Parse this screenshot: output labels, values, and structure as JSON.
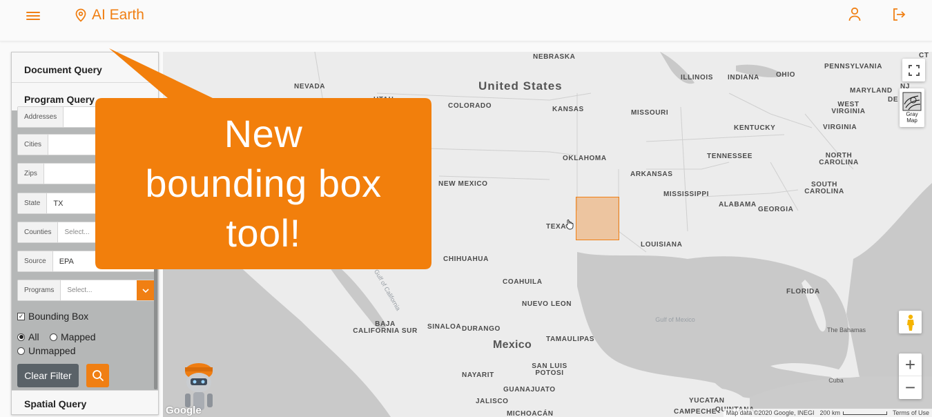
{
  "header": {
    "brand": "AI Earth",
    "menu_icon": "hamburger-icon",
    "pin_icon": "map-pin-icon",
    "user_icon": "user-icon",
    "logout_icon": "logout-icon",
    "accent": "#f07f13"
  },
  "sidebar": {
    "document_query": "Document Query",
    "program_query": "Program Query",
    "spatial_query": "Spatial Query",
    "fields": {
      "addresses": {
        "label": "Addresses",
        "value": ""
      },
      "cities": {
        "label": "Cities",
        "value": ""
      },
      "zips": {
        "label": "Zips",
        "value": ""
      },
      "state": {
        "label": "State",
        "value": "TX"
      },
      "counties": {
        "label": "Counties",
        "placeholder": "Select..."
      },
      "source": {
        "label": "Source",
        "value": "EPA"
      },
      "programs": {
        "label": "Programs",
        "placeholder": "Select..."
      }
    },
    "bounding_box_label": "Bounding Box",
    "bounding_box_checked": true,
    "radio_all": "All",
    "radio_mapped": "Mapped",
    "radio_unmapped": "Unmapped",
    "radio_selected": "All",
    "clear_filter": "Clear Filter",
    "search_icon": "search-icon"
  },
  "callout": {
    "line1": "New",
    "line2": "bounding box",
    "line3": "tool!",
    "color": "#f27f0c"
  },
  "map": {
    "country_us": "United States",
    "country_mexico": "Mexico",
    "states": [
      "NEBRASKA",
      "NEVADA",
      "UTAH",
      "COLORADO",
      "KANSAS",
      "MISSOURI",
      "ILLINOIS",
      "INDIANA",
      "OHIO",
      "PENNSYLVANIA",
      "MARYLAND",
      "NJ",
      "DE",
      "WEST VIRGINIA",
      "VIRGINIA",
      "KENTUCKY",
      "TENNESSEE",
      "NORTH CAROLINA",
      "OKLAHOMA",
      "ARKANSAS",
      "NEW MEXICO",
      "SOUTH CAROLINA",
      "MISSISSIPPI",
      "ALABAMA",
      "GEORGIA",
      "TEXAS",
      "LOUISIANA",
      "CHIHUAHUA",
      "COAHUILA",
      "FLORIDA",
      "NUEVO LEON",
      "BAJA CALIFORNIA SUR",
      "SINALOA",
      "DURANGO",
      "TAMAULIPAS",
      "SAN LUIS POTOSI",
      "NAYARIT",
      "GUANAJUATO",
      "JALISCO",
      "MICHOACÁN",
      "YUCATAN",
      "CAMPECHE",
      "QUINTANA",
      "CT"
    ],
    "water": {
      "gulf_mexico": "Gulf of Mexico",
      "gulf_california": "Gulf of California"
    },
    "places": {
      "bahamas": "The Bahamas",
      "cuba": "Cuba"
    },
    "map_type_label": "Gray Map",
    "fullscreen_icon": "fullscreen-icon",
    "pegman_icon": "pegman-icon",
    "zoom_in": "+",
    "zoom_out": "−",
    "footer": {
      "attribution": "Map data ©2020 Google, INEGI",
      "scale": "200 km",
      "terms": "Terms of Use"
    },
    "google": "Google",
    "mascot": "mascot-robot-icon"
  }
}
